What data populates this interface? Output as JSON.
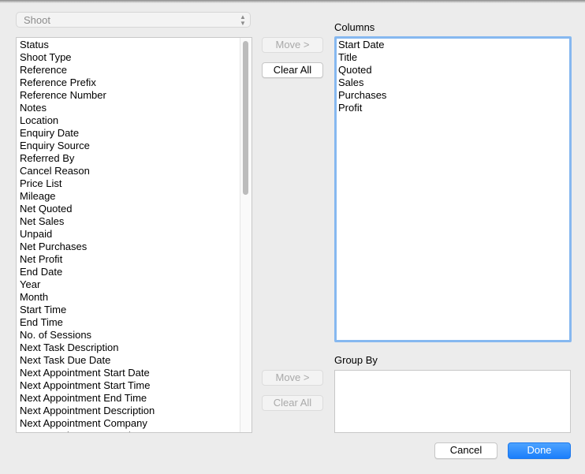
{
  "source_select": {
    "value": "Shoot"
  },
  "available_fields": [
    "Status",
    "Shoot Type",
    "Reference",
    "Reference Prefix",
    "Reference Number",
    "Notes",
    "Location",
    "Enquiry Date",
    "Enquiry Source",
    "Referred By",
    "Cancel Reason",
    "Price List",
    "Mileage",
    "Net Quoted",
    "Net Sales",
    "Unpaid",
    "Net Purchases",
    "Net Profit",
    "End Date",
    "Year",
    "Month",
    "Start Time",
    "End Time",
    "No. of Sessions",
    "Next Task Description",
    "Next Task Due Date",
    "Next Appointment Start Date",
    "Next Appointment Start Time",
    "Next Appointment End Time",
    "Next Appointment Description",
    "Next Appointment Company",
    "Next Appointment Location"
  ],
  "columns_section": {
    "label": "Columns",
    "move_label": "Move >",
    "clear_label": "Clear All",
    "items": [
      "Start Date",
      "Title",
      "Quoted",
      "Sales",
      "Purchases",
      "Profit"
    ]
  },
  "group_by_section": {
    "label": "Group By",
    "move_label": "Move >",
    "clear_label": "Clear All",
    "items": []
  },
  "footer": {
    "cancel_label": "Cancel",
    "done_label": "Done"
  },
  "colors": {
    "accent": "#1a7efb",
    "focus_ring": "#86b8f0"
  }
}
